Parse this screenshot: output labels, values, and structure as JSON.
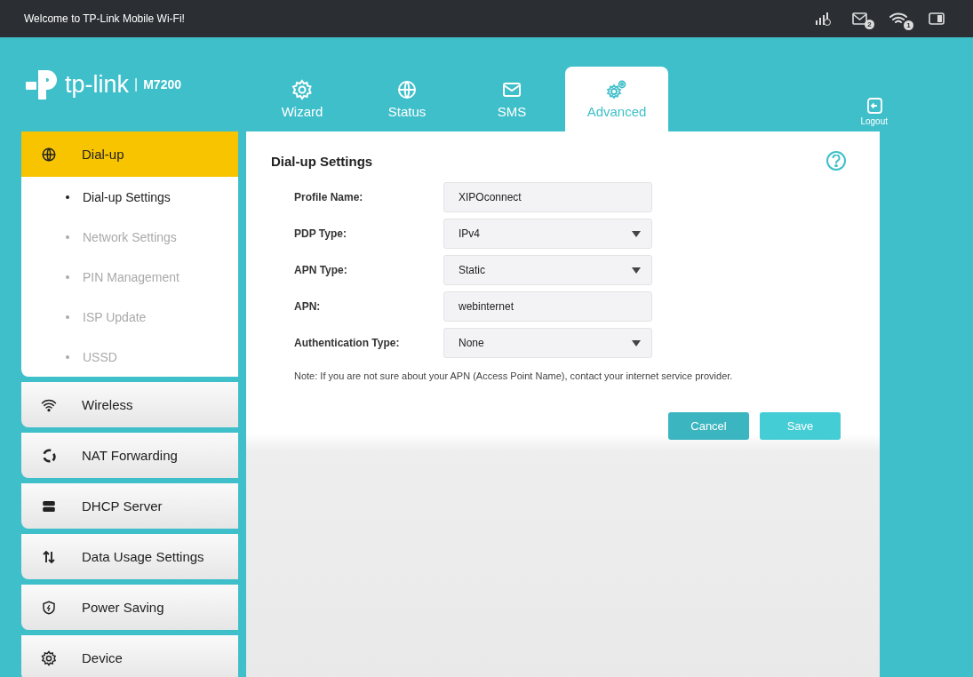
{
  "top_bar": {
    "title": "Welcome to TP-Link Mobile Wi-Fi!",
    "sms_badge": "2",
    "wifi_badge": "1"
  },
  "logo": {
    "brand": "tp-link",
    "separator": "|",
    "model": "M7200"
  },
  "tabs": [
    {
      "label": "Wizard",
      "selected": false
    },
    {
      "label": "Status",
      "selected": false
    },
    {
      "label": "SMS",
      "selected": false
    },
    {
      "label": "Advanced",
      "selected": true
    }
  ],
  "logout": "Logout",
  "sidebar": {
    "items": [
      {
        "label": "Dial-up",
        "selected": true,
        "expanded": true,
        "children": [
          {
            "label": "Dial-up Settings",
            "selected": true
          },
          {
            "label": "Network Settings",
            "selected": false
          },
          {
            "label": "PIN Management",
            "selected": false
          },
          {
            "label": "ISP Update",
            "selected": false
          },
          {
            "label": "USSD",
            "selected": false
          }
        ]
      },
      {
        "label": "Wireless",
        "selected": false,
        "expanded": false
      },
      {
        "label": "NAT Forwarding",
        "selected": false,
        "expanded": false
      },
      {
        "label": "DHCP Server",
        "selected": false,
        "expanded": false
      },
      {
        "label": "Data Usage Settings",
        "selected": false,
        "expanded": false
      },
      {
        "label": "Power Saving",
        "selected": false,
        "expanded": false
      },
      {
        "label": "Device",
        "selected": false,
        "expanded": false
      }
    ]
  },
  "content": {
    "title": "Dial-up Settings",
    "fields": [
      {
        "label": "Profile Name:",
        "kind": "text",
        "value": "XIPOconnect"
      },
      {
        "label": "PDP Type:",
        "kind": "select",
        "value": "IPv4"
      },
      {
        "label": "APN Type:",
        "kind": "select",
        "value": "Static"
      },
      {
        "label": "APN:",
        "kind": "text",
        "value": "webinternet"
      },
      {
        "label": "Authentication Type:",
        "kind": "select",
        "value": "None"
      }
    ],
    "note": "Note: If you are not sure about your APN (Access Point Name), contact your internet service provider.",
    "buttons": [
      {
        "label": "Cancel",
        "kind": "secondary"
      },
      {
        "label": "Save",
        "kind": "primary"
      }
    ]
  }
}
